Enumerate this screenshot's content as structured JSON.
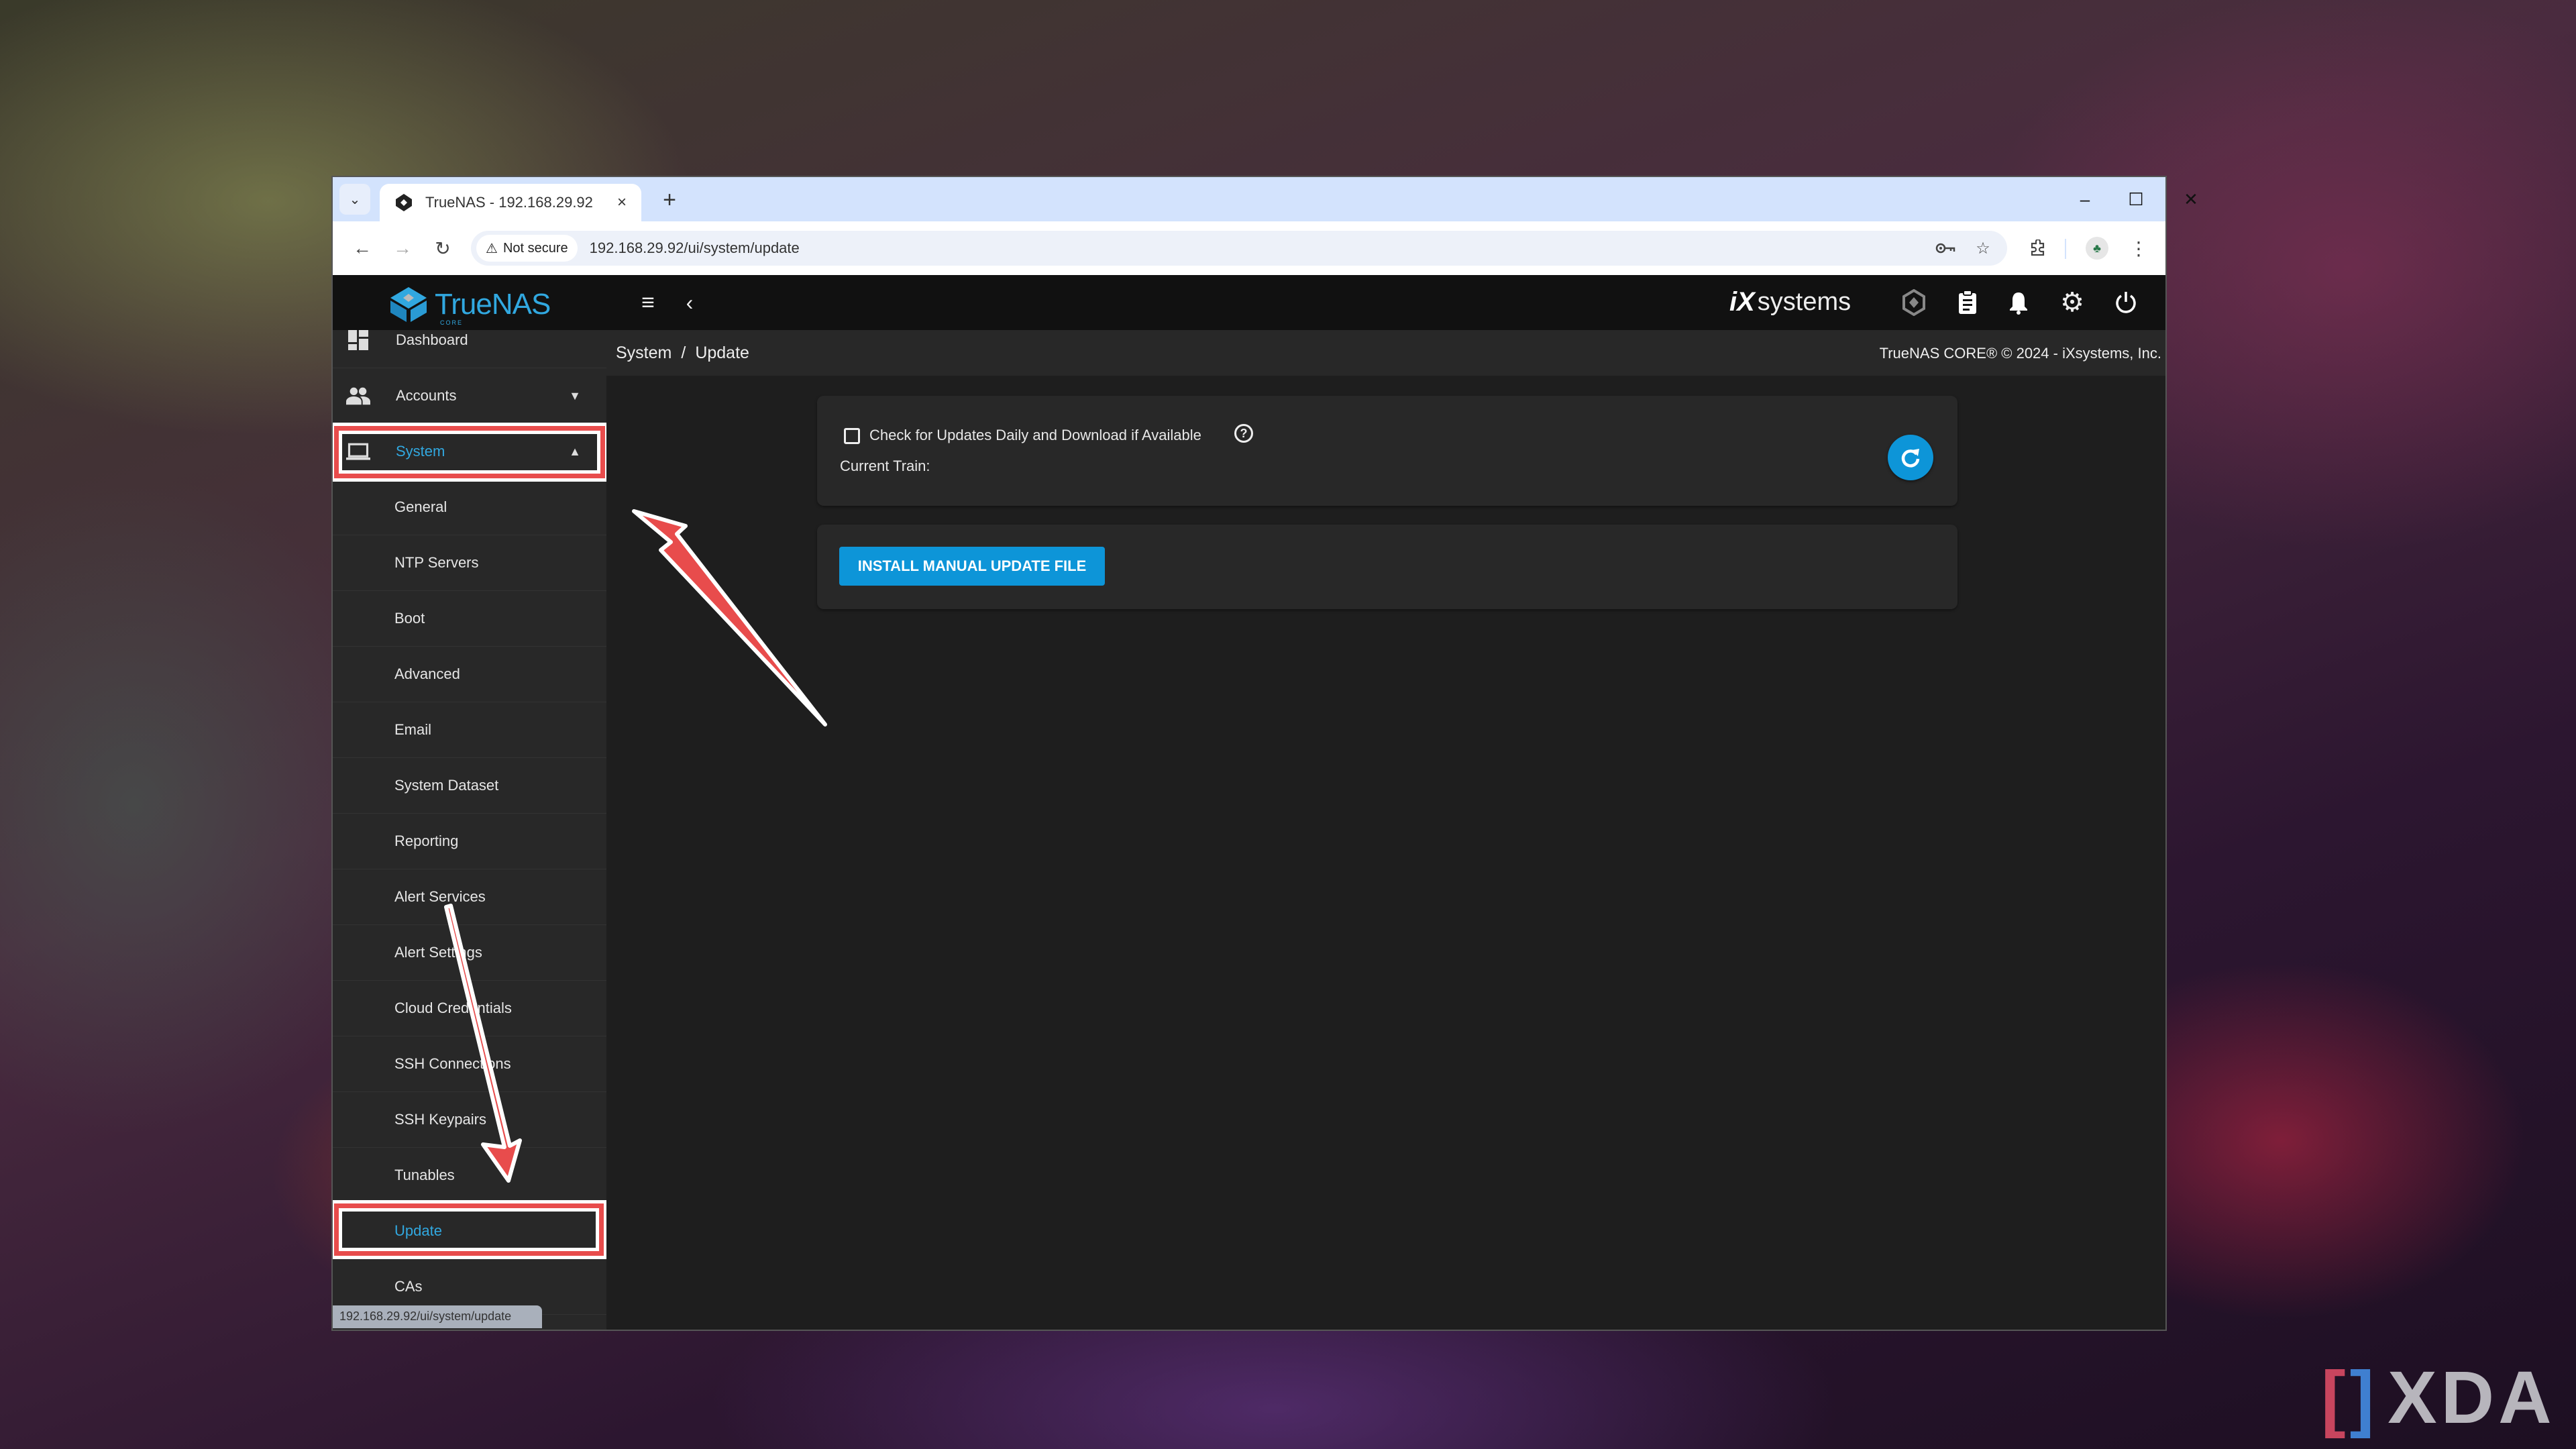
{
  "browser": {
    "tab_title": "TrueNAS - 192.168.29.92",
    "tab_close": "×",
    "new_tab": "+",
    "security_label": "Not secure",
    "url": "192.168.29.92/ui/system/update",
    "status_url": "192.168.29.92/ui/system/update",
    "window_controls": {
      "minimize": "–",
      "maximize": "☐",
      "close": "✕"
    }
  },
  "app": {
    "logo_text": "TrueNAS",
    "logo_sub": "CORE",
    "vendor_logo_ix": "iX",
    "vendor_logo_text": "systems",
    "copyright": "TrueNAS CORE® © 2024 - iXsystems, Inc.",
    "accent_color": "#0d95d8",
    "highlight_color": "#e84c4c"
  },
  "breadcrumb": {
    "items": [
      "System",
      "Update"
    ],
    "separator": "/"
  },
  "sidebar": {
    "items": [
      {
        "label": "Dashboard",
        "icon": "dashboard-icon"
      },
      {
        "label": "Accounts",
        "icon": "people-icon",
        "expandable": true,
        "expanded": false
      },
      {
        "label": "System",
        "icon": "laptop-icon",
        "expandable": true,
        "expanded": true,
        "active": true
      }
    ],
    "system_children": [
      {
        "label": "General"
      },
      {
        "label": "NTP Servers"
      },
      {
        "label": "Boot"
      },
      {
        "label": "Advanced"
      },
      {
        "label": "Email"
      },
      {
        "label": "System Dataset"
      },
      {
        "label": "Reporting"
      },
      {
        "label": "Alert Services"
      },
      {
        "label": "Alert Settings"
      },
      {
        "label": "Cloud Credentials"
      },
      {
        "label": "SSH Connections"
      },
      {
        "label": "SSH Keypairs"
      },
      {
        "label": "Tunables"
      },
      {
        "label": "Update",
        "active": true
      },
      {
        "label": "CAs"
      }
    ]
  },
  "update_page": {
    "auto_check_label": "Check for Updates Daily and Download if Available",
    "auto_check_checked": false,
    "help_glyph": "?",
    "current_train_label": "Current Train:",
    "current_train_value": "",
    "install_manual_button": "INSTALL MANUAL UPDATE FILE"
  },
  "watermark": {
    "bracket_left": "[",
    "bracket_right": "]",
    "text": "XDA"
  }
}
